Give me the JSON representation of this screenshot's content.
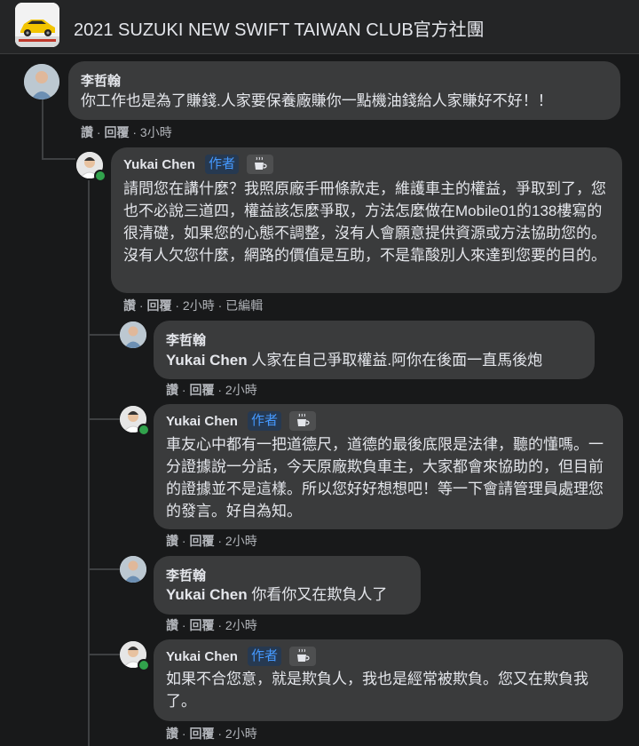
{
  "group": {
    "title": "2021 SUZUKI NEW SWIFT TAIWAN CLUB官方社團"
  },
  "actions": {
    "like": "讚",
    "reply": "回覆",
    "sep": " · "
  },
  "comments": [
    {
      "author": "李哲翰",
      "text": "你工作也是為了賺錢.人家要保養廠賺你一點機油錢給人家賺好不好！！",
      "time": "3小時"
    },
    {
      "author": "Yukai Chen",
      "badge": "作者",
      "badge_icon": "coffee-cup-icon",
      "text": "請問您在講什麼？我照原廠手冊條款走，維護車主的權益，爭取到了，您也不必說三道四，權益該怎麼爭取，方法怎麼做在Mobile01的138樓寫的很清礎，如果您的心態不調整，沒有人會願意提供資源或方法協助您的。沒有人欠您什麼，網路的價值是互助，不是靠酸別人來達到您要的目的。",
      "time": "2小時",
      "edited": "已編輯"
    },
    {
      "author": "李哲翰",
      "mention": "Yukai Chen",
      "text": " 人家在自己爭取權益.阿你在後面一直馬後炮",
      "time": "2小時"
    },
    {
      "author": "Yukai Chen",
      "badge": "作者",
      "badge_icon": "coffee-cup-icon",
      "text": "車友心中都有一把道德尺，道德的最後底限是法律，聽的懂嗎。一分證據說一分話，今天原廠欺負車主，大家都會來協助的，但目前的證據並不是這樣。所以您好好想想吧！等一下會請管理員處理您的發言。好自為知。",
      "time": "2小時"
    },
    {
      "author": "李哲翰",
      "mention": "Yukai Chen",
      "text": " 你看你又在欺負人了",
      "time": "2小時"
    },
    {
      "author": "Yukai Chen",
      "badge": "作者",
      "badge_icon": "coffee-cup-icon",
      "text": "如果不合您意，就是欺負人，我也是經常被欺負。您又在欺負我了。",
      "time": "2小時"
    }
  ]
}
